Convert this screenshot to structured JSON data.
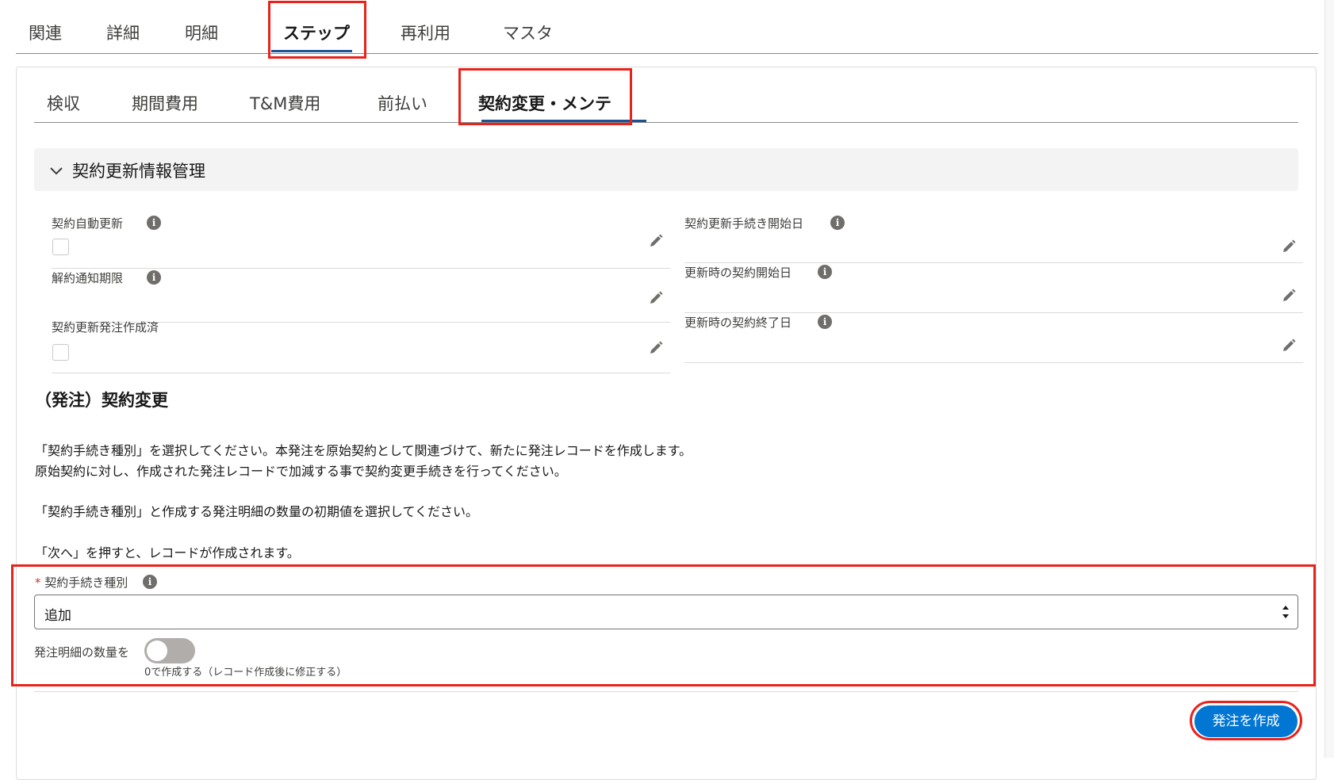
{
  "top_tabs": {
    "items": [
      {
        "label": "関連"
      },
      {
        "label": "詳細"
      },
      {
        "label": "明細"
      },
      {
        "label": "ステップ"
      },
      {
        "label": "再利用"
      },
      {
        "label": "マスタ"
      }
    ],
    "active": "ステップ"
  },
  "sub_tabs": {
    "items": [
      {
        "label": "検収"
      },
      {
        "label": "期間費用"
      },
      {
        "label": "T&M費用"
      },
      {
        "label": "前払い"
      },
      {
        "label": "契約変更・メンテ"
      }
    ],
    "active": "契約変更・メンテ"
  },
  "section": {
    "title": "契約更新情報管理",
    "left_fields": [
      {
        "label": "契約自動更新",
        "type": "checkbox",
        "checked": false
      },
      {
        "label": "解約通知期限",
        "type": "text",
        "value": ""
      },
      {
        "label": "契約更新発注作成済",
        "type": "checkbox",
        "checked": false
      }
    ],
    "right_fields": [
      {
        "label": "契約更新手続き開始日",
        "type": "text",
        "value": ""
      },
      {
        "label": "更新時の契約開始日",
        "type": "text",
        "value": ""
      },
      {
        "label": "更新時の契約終了日",
        "type": "text",
        "value": ""
      }
    ]
  },
  "order_change": {
    "heading": "（発注）契約変更",
    "paragraphs": [
      "「契約手続き種別」を選択してください。本発注を原始契約として関連づけて、新たに発注レコードを作成します。",
      "原始契約に対し、作成された発注レコードで加減する事で契約変更手続きを行ってください。",
      "「契約手続き種別」と作成する発注明細の数量の初期値を選択してください。",
      "「次へ」を押すと、レコードが作成されます。"
    ],
    "procedure_type": {
      "required_mark": "*",
      "label": "契約手続き種別",
      "value": "追加"
    },
    "quantity_toggle": {
      "label": "発注明細の数量を",
      "caption": "0で作成する（レコード作成後に修正する）",
      "on": false
    },
    "submit_label": "発注を作成"
  },
  "colors": {
    "highlight": "#e8231c",
    "primary": "#0176d3",
    "tab_underline": "#1b5297"
  }
}
